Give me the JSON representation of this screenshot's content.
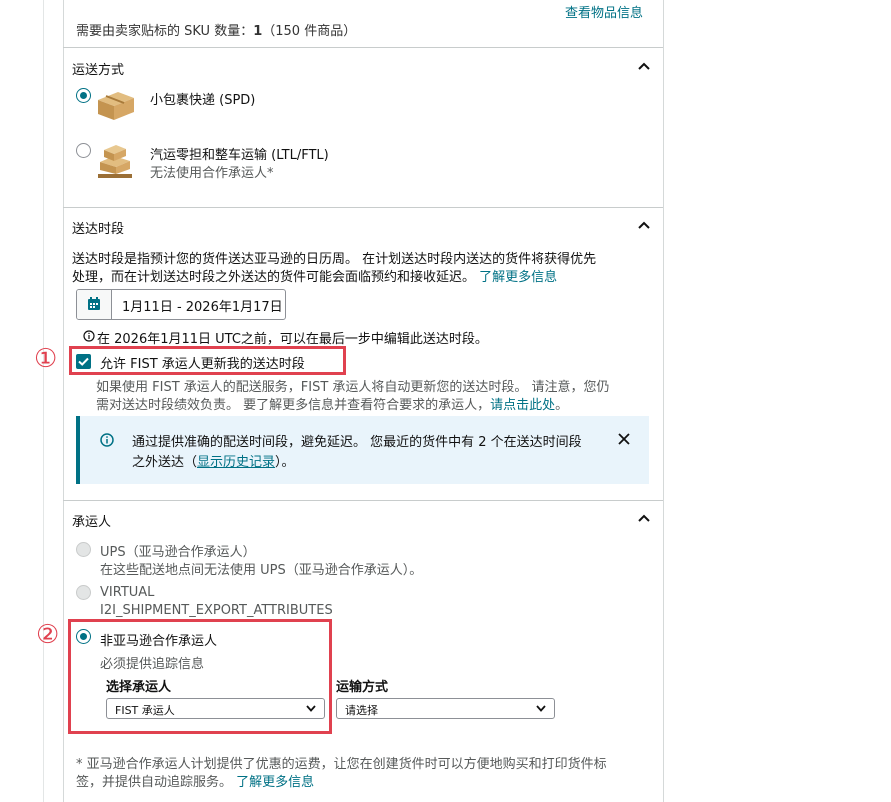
{
  "header": {
    "view_items_link": "查看物品信息",
    "sku_prefix": "需要由卖家贴标的 SKU 数量：",
    "sku_count": "1",
    "sku_suffix": "（150 件商品）"
  },
  "shipping_mode": {
    "title": "运送方式",
    "options": [
      {
        "label": "小包裹快递 (SPD)",
        "selected": true,
        "icon": "small-parcel-box-icon"
      },
      {
        "label": "汽运零担和整车运输 (LTL/FTL)",
        "sublabel": "无法使用合作承运人*",
        "selected": false,
        "icon": "pallet-boxes-icon"
      }
    ]
  },
  "delivery_window": {
    "title": "送达时段",
    "desc_line1": "送达时段是指预计您的货件送达亚马逊的日历周。 在计划送达时段内送达的货件将获得优先",
    "desc_line2": "处理，而在计划送达时段之外送达的货件可能会面临预约和接收延迟。",
    "learn_more": "了解更多信息",
    "date_value": "1月11日 - 2026年1月17日",
    "edit_note": "在 2026年1月11日 UTC之前，可以在最后一步中编辑此送达时段。",
    "fist_checkbox_label": "允许 FIST 承运人更新我的送达时段",
    "fist_checked": true,
    "fist_desc_line1": "如果使用 FIST 承运人的配送服务，FIST 承运人将自动更新您的送达时段。 请注意，您仍",
    "fist_desc_line2": "需对送达时段绩效负责。 要了解更多信息并查看符合要求的承运人，",
    "fist_link": "请点击此处",
    "fist_desc_end": "。",
    "alert_line1": "通过提供准确的配送时间段，避免延迟。 您最近的货件中有 2 个在送达时间段",
    "alert_line2_prefix": "之外送达（",
    "alert_link": "显示历史记录",
    "alert_line2_suffix": "）。"
  },
  "carrier": {
    "title": "承运人",
    "ups_label": "UPS（亚马逊合作承运人）",
    "ups_sub": "在这些配送地点间无法使用 UPS（亚马逊合作承运人）。",
    "virtual_label": "VIRTUAL",
    "virtual_sub": "I2I_SHIPMENT_EXPORT_ATTRIBUTES",
    "non_partner_label": "非亚马逊合作承运人",
    "non_partner_sub": "必须提供追踪信息",
    "select_carrier_label": "选择承运人",
    "select_carrier_value": "FIST 承运人",
    "shipping_method_label": "运输方式",
    "shipping_method_value": "请选择",
    "footnote_line1": "* 亚马逊合作承运人计划提供了优惠的运费，让您在创建货件时可以方便地购买和打印货件标",
    "footnote_line2": "签，并提供自动追踪服务。",
    "footnote_link": "了解更多信息"
  },
  "annotations": {
    "marker_1": "①",
    "marker_2": "②"
  },
  "colors": {
    "link": "#007185",
    "highlight": "#e0414f",
    "alert_bg": "#e9f4fb",
    "checkbox": "#007185"
  }
}
